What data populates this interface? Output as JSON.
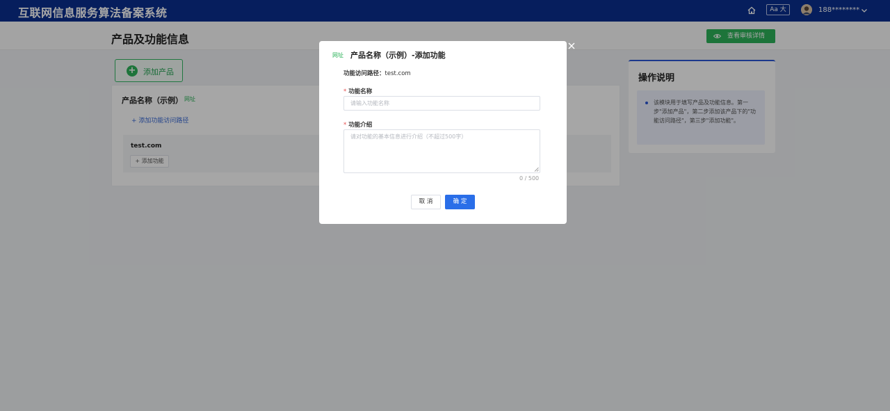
{
  "header": {
    "title": "互联网信息服务算法备案系统",
    "font_button": "Aa 大",
    "username": "188********"
  },
  "page": {
    "title": "产品及功能信息",
    "audit_button": "查看审核详情",
    "add_product": "添加产品"
  },
  "product_card": {
    "name": "产品名称（示例）",
    "tag": "网址",
    "add_path": "+ 添加功能访问路径",
    "path_domain": "test.com",
    "add_function": "+ 添加功能"
  },
  "help_panel": {
    "title": "操作说明",
    "text": "该模块用于填写产品及功能信息。第一步\"添加产品\"，第二步添加该产品下的\"功能访问路径\"，第三步\"添加功能\"。"
  },
  "modal": {
    "tag": "网址",
    "title": "产品名称（示例）-添加功能",
    "path_label": "功能访问路径：",
    "path_value": "test.com",
    "name_label": "功能名称",
    "name_placeholder": "请输入功能名称",
    "intro_label": "功能介绍",
    "intro_placeholder": "请对功能的基本信息进行介绍（不超过500字）",
    "counter": "0 / 500",
    "cancel": "取 消",
    "confirm": "确 定"
  },
  "colors": {
    "header_bg": "#0a2f8f",
    "primary_blue": "#2a6ee8",
    "accent_green": "#2db35a",
    "required_red": "#e54b4b"
  }
}
